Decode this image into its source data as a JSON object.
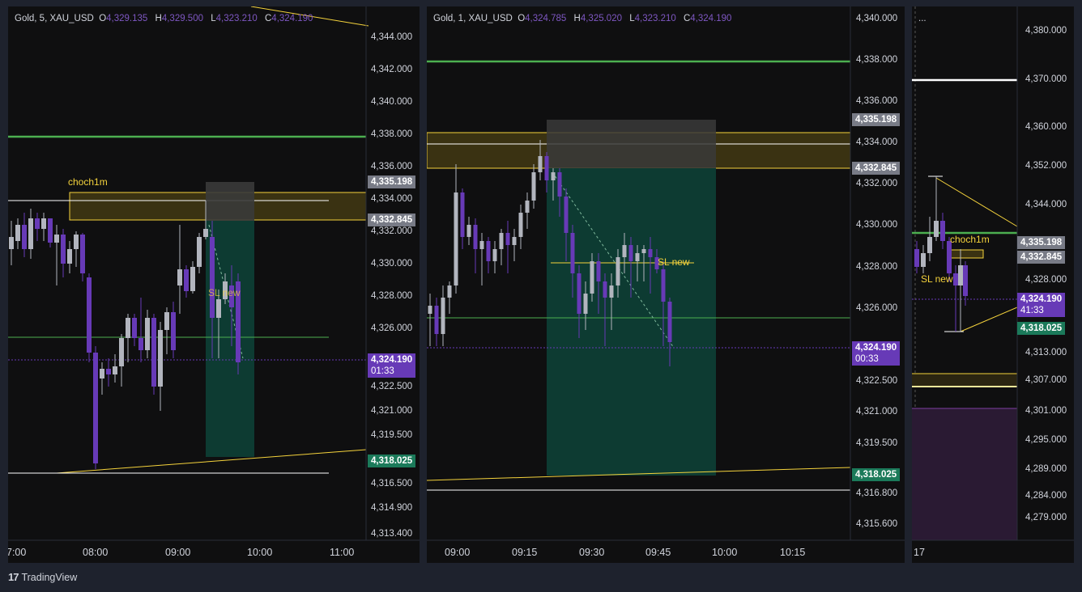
{
  "panel1": {
    "legend": {
      "symbol": "Gold, 5, XAU_USD",
      "o_key": "O",
      "o": "4,329.135",
      "h_key": "H",
      "h": "4,329.500",
      "l_key": "L",
      "l": "4,323.210",
      "c_key": "C",
      "c": "4,324.190"
    },
    "price_axis": [
      "4,344.000",
      "4,342.000",
      "4,340.000",
      "4,338.000",
      "4,336.000",
      "4,334.000",
      "4,332.000",
      "4,330.000",
      "4,328.000",
      "4,326.000",
      "4,322.500",
      "4,321.000",
      "4,319.500",
      "4,316.500",
      "4,314.900",
      "4,313.400"
    ],
    "tags": {
      "t1": "4,335.198",
      "t2": "4,332.845",
      "current": "4,324.190",
      "countdown": "01:33",
      "tp": "4,318.025"
    },
    "time_axis": [
      "7:00",
      "08:00",
      "09:00",
      "10:00",
      "11:00"
    ],
    "labels": {
      "zone": "choch1m",
      "sl": "SL new"
    }
  },
  "panel2": {
    "legend": {
      "symbol": "Gold, 1, XAU_USD",
      "o_key": "O",
      "o": "4,324.785",
      "h_key": "H",
      "h": "4,325.020",
      "l_key": "L",
      "l": "4,323.210",
      "c_key": "C",
      "c": "4,324.190"
    },
    "price_axis": [
      "4,340.000",
      "4,338.000",
      "4,336.000",
      "4,334.000",
      "4,332.000",
      "4,330.000",
      "4,328.000",
      "4,326.000",
      "4,322.500",
      "4,321.000",
      "4,319.500",
      "4,316.800",
      "4,315.600"
    ],
    "tags": {
      "t1": "4,335.198",
      "t2": "4,332.845",
      "current": "4,324.190",
      "countdown": "00:33",
      "tp": "4,318.025"
    },
    "time_axis": [
      "09:00",
      "09:15",
      "09:30",
      "09:45",
      "10:00",
      "10:15"
    ],
    "labels": {
      "sl": "SL new"
    }
  },
  "panel3": {
    "legend": {
      "menu": "..."
    },
    "price_axis": [
      "4,380.000",
      "4,370.000",
      "4,360.000",
      "4,352.000",
      "4,344.000",
      "4,328.000",
      "4,313.000",
      "4,307.000",
      "4,301.000",
      "4,295.000",
      "4,289.000",
      "4,284.000",
      "4,279.000"
    ],
    "tags": {
      "t1": "4,335.198",
      "t2": "4,332.845",
      "current": "4,324.190",
      "countdown": "41:33",
      "tp": "4,318.025"
    },
    "time_axis": [
      "17"
    ],
    "labels": {
      "zone": "choch1m",
      "sl": "SL new"
    }
  },
  "footer": {
    "logo": "17",
    "brand": "TradingView"
  },
  "colors": {
    "bull": "#b2b5be",
    "bear": "#673ab7",
    "green_line": "#4caf50",
    "zone": "#f5d33c",
    "tp_zone": "#0d3b32",
    "current_tag": "#673ab7"
  }
}
